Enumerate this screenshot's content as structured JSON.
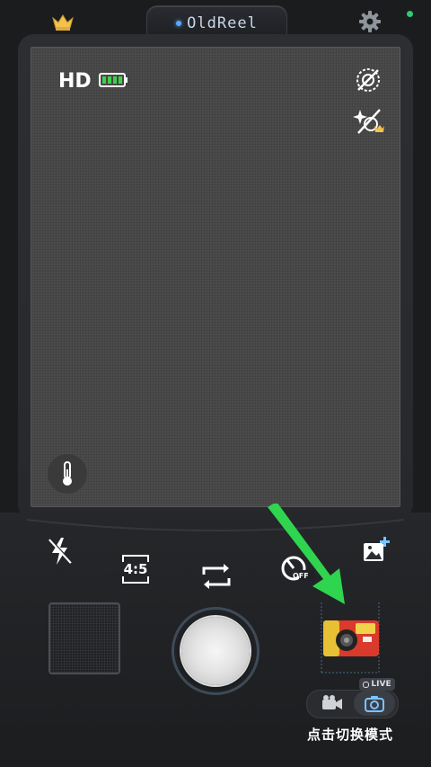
{
  "header": {
    "app_name": "OldReel"
  },
  "viewfinder": {
    "quality_label": "HD"
  },
  "controls": {
    "ratio_label": "4:5",
    "timer_state": "OFF"
  },
  "mode_switch": {
    "live_badge": "LIVE",
    "hint_text": "点击切换模式"
  },
  "icons": {
    "crown": "crown-icon",
    "settings": "gear-icon",
    "battery": "battery-icon",
    "filter_off": "no-filter-icon",
    "effects": "sparkle-effects-icon",
    "temperature": "thermometer-icon",
    "flash": "flash-off-icon",
    "flip": "flip-camera-icon",
    "timer": "timer-icon",
    "add_photo": "add-photo-icon",
    "camera_model": "camera-model-icon",
    "video": "video-camera-icon",
    "photo": "photo-camera-icon"
  },
  "colors": {
    "accent_green": "#2ecc71",
    "arrow_green": "#2fd44f",
    "crown_gold": "#f2c14e",
    "title_dot": "#58a8ff"
  }
}
